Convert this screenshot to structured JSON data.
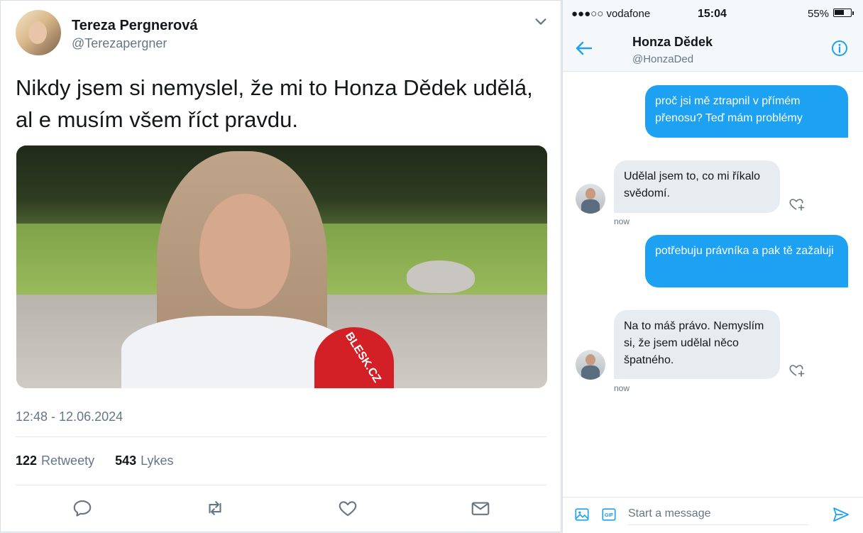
{
  "tweet": {
    "author_name": "Tereza Pergnerová",
    "author_handle": "@Terezapergner",
    "text": "Nikdy jsem si nemyslel, že mi to Honza Dědek udělá, al e musím všem říct pravdu.",
    "media_caption": "BLESK.CZ",
    "timestamp": "12:48 - 12.06.2024",
    "retweets_count": "122",
    "retweets_label": "Retweety",
    "likes_count": "543",
    "likes_label": "Lykes",
    "actions": [
      "reply-icon",
      "retweet-icon",
      "like-icon",
      "message-icon"
    ]
  },
  "phone": {
    "carrier": "●●●○○ vodafone",
    "time": "15:04",
    "battery": "55%"
  },
  "dm": {
    "contact_name": "Honza Dědek",
    "contact_handle": "@HonzaDed",
    "messages": [
      {
        "direction": "out",
        "text": "proč jsi mě ztrapnil v přímém přenosu? Teď mám problémy"
      },
      {
        "direction": "in",
        "text": "Udělal jsem to, co mi říkalo svědomí.",
        "time": "now"
      },
      {
        "direction": "out",
        "text": "potřebuju právníka a pak tě zažaluji"
      },
      {
        "direction": "in",
        "text": "Na to máš právo. Nemyslím si, že jsem udělal něco špatného.",
        "time": "now"
      }
    ],
    "composer_placeholder": "Start a message",
    "gif_label": "GIF"
  },
  "colors": {
    "accent": "#1da1f2",
    "text": "#14171a",
    "muted": "#657786"
  }
}
